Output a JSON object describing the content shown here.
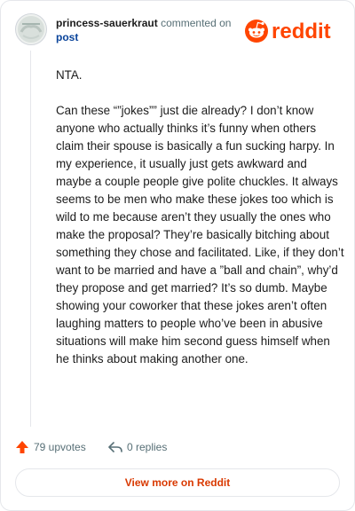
{
  "header": {
    "username": "princess-sauerkraut",
    "action_text": " commented on",
    "post_label": "post",
    "logo_text": "reddit"
  },
  "comment": {
    "paragraphs": [
      "NTA.",
      "Can these “”jokes”” just die already? I don’t know anyone who actually thinks it’s funny when others claim their spouse is basically a fun sucking harpy. In my experience, it usually just gets awkward and maybe a couple people give polite chuckles. It always seems to be men who make these jokes too which is wild to me because aren’t they usually the ones who make the proposal? They’re basically bitching about something they chose and facilitated. Like, if they don’t want to be married and have a ”ball and chain”, why’d they propose and get married? It’s so dumb. Maybe showing your coworker that these jokes aren’t often laughing matters to people who’ve been in abusive situations will make him second guess himself when he thinks about making another one."
    ]
  },
  "actions": {
    "upvotes": "79 upvotes",
    "replies": "0 replies"
  },
  "footer": {
    "view_more": "View more on Reddit"
  },
  "colors": {
    "accent": "#ff4500",
    "link": "#0a449b",
    "muted": "#576f76",
    "view_more": "#d93900"
  },
  "icons": {
    "avatar": "snoo-avatar",
    "logo": "reddit-alien-icon",
    "upvote": "upvote-arrow-icon",
    "reply": "reply-arrow-icon"
  }
}
